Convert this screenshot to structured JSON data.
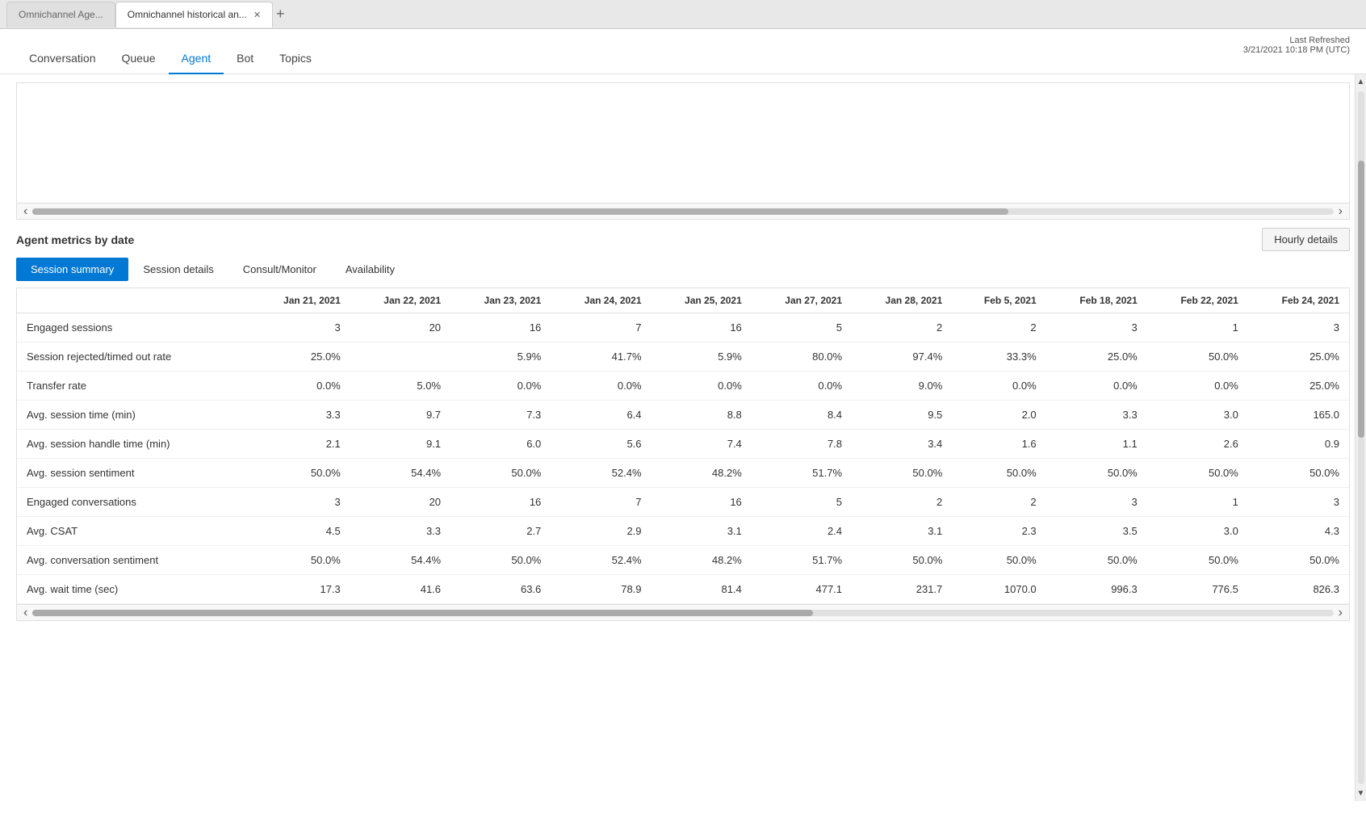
{
  "browser": {
    "tabs": [
      {
        "label": "Omnichannel Age...",
        "active": false
      },
      {
        "label": "Omnichannel historical an...",
        "active": true
      }
    ],
    "add_tab": "+"
  },
  "nav": {
    "items": [
      "Conversation",
      "Queue",
      "Agent",
      "Bot",
      "Topics"
    ],
    "active": "Agent",
    "last_refreshed_label": "Last Refreshed",
    "last_refreshed_value": "3/21/2021 10:18 PM (UTC)"
  },
  "table_section": {
    "title": "Agent metrics by date",
    "hourly_btn": "Hourly details",
    "sub_tabs": [
      "Session summary",
      "Session details",
      "Consult/Monitor",
      "Availability"
    ],
    "active_sub_tab": "Session summary"
  },
  "columns": [
    "",
    "Jan 21, 2021",
    "Jan 22, 2021",
    "Jan 23, 2021",
    "Jan 24, 2021",
    "Jan 25, 2021",
    "Jan 27, 2021",
    "Jan 28, 2021",
    "Feb 5, 2021",
    "Feb 18, 2021",
    "Feb 22, 2021",
    "Feb 24, 2021"
  ],
  "rows": [
    {
      "label": "Engaged sessions",
      "values": [
        "3",
        "20",
        "16",
        "7",
        "16",
        "5",
        "2",
        "2",
        "3",
        "1",
        "3"
      ]
    },
    {
      "label": "Session rejected/timed out rate",
      "values": [
        "25.0%",
        "",
        "5.9%",
        "41.7%",
        "5.9%",
        "80.0%",
        "97.4%",
        "33.3%",
        "25.0%",
        "50.0%",
        "25.0%"
      ]
    },
    {
      "label": "Transfer rate",
      "values": [
        "0.0%",
        "5.0%",
        "0.0%",
        "0.0%",
        "0.0%",
        "0.0%",
        "9.0%",
        "0.0%",
        "0.0%",
        "0.0%",
        "25.0%"
      ]
    },
    {
      "label": "Avg. session time (min)",
      "values": [
        "3.3",
        "9.7",
        "7.3",
        "6.4",
        "8.8",
        "8.4",
        "9.5",
        "2.0",
        "3.3",
        "3.0",
        "165.0"
      ]
    },
    {
      "label": "Avg. session handle time (min)",
      "values": [
        "2.1",
        "9.1",
        "6.0",
        "5.6",
        "7.4",
        "7.8",
        "3.4",
        "1.6",
        "1.1",
        "2.6",
        "0.9"
      ]
    },
    {
      "label": "Avg. session sentiment",
      "values": [
        "50.0%",
        "54.4%",
        "50.0%",
        "52.4%",
        "48.2%",
        "51.7%",
        "50.0%",
        "50.0%",
        "50.0%",
        "50.0%",
        "50.0%"
      ]
    },
    {
      "label": "Engaged conversations",
      "values": [
        "3",
        "20",
        "16",
        "7",
        "16",
        "5",
        "2",
        "2",
        "3",
        "1",
        "3"
      ]
    },
    {
      "label": "Avg. CSAT",
      "values": [
        "4.5",
        "3.3",
        "2.7",
        "2.9",
        "3.1",
        "2.4",
        "3.1",
        "2.3",
        "3.5",
        "3.0",
        "4.3"
      ]
    },
    {
      "label": "Avg. conversation sentiment",
      "values": [
        "50.0%",
        "54.4%",
        "50.0%",
        "52.4%",
        "48.2%",
        "51.7%",
        "50.0%",
        "50.0%",
        "50.0%",
        "50.0%",
        "50.0%"
      ]
    },
    {
      "label": "Avg. wait time (sec)",
      "values": [
        "17.3",
        "41.6",
        "63.6",
        "78.9",
        "81.4",
        "477.1",
        "231.7",
        "1070.0",
        "996.3",
        "776.5",
        "826.3"
      ]
    }
  ]
}
